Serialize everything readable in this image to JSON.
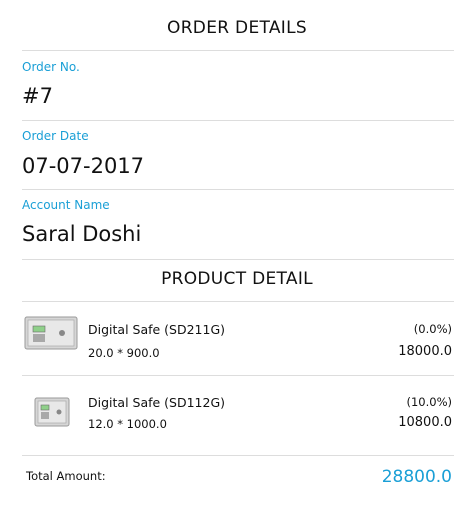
{
  "header": {
    "title": "ORDER DETAILS"
  },
  "order": {
    "number_label": "Order No.",
    "number_value": "#7",
    "date_label": "Order Date",
    "date_value": "07-07-2017",
    "account_label": "Account Name",
    "account_value": "Saral Doshi"
  },
  "products_section": {
    "title": "PRODUCT DETAIL",
    "items": [
      {
        "name": "Digital Safe (SD211G)",
        "qty_price": "20.0 * 900.0",
        "discount": "(0.0%)",
        "total": "18000.0",
        "image_icon": "safe-icon"
      },
      {
        "name": "Digital Safe (SD112G)",
        "qty_price": "12.0 * 1000.0",
        "discount": "(10.0%)",
        "total": "10800.0",
        "image_icon": "safe-icon"
      }
    ]
  },
  "summary": {
    "total_label": "Total Amount:",
    "total_value": "28800.0"
  },
  "colors": {
    "accent": "#1a9fd6",
    "divider": "#dddddd",
    "text": "#111111"
  }
}
